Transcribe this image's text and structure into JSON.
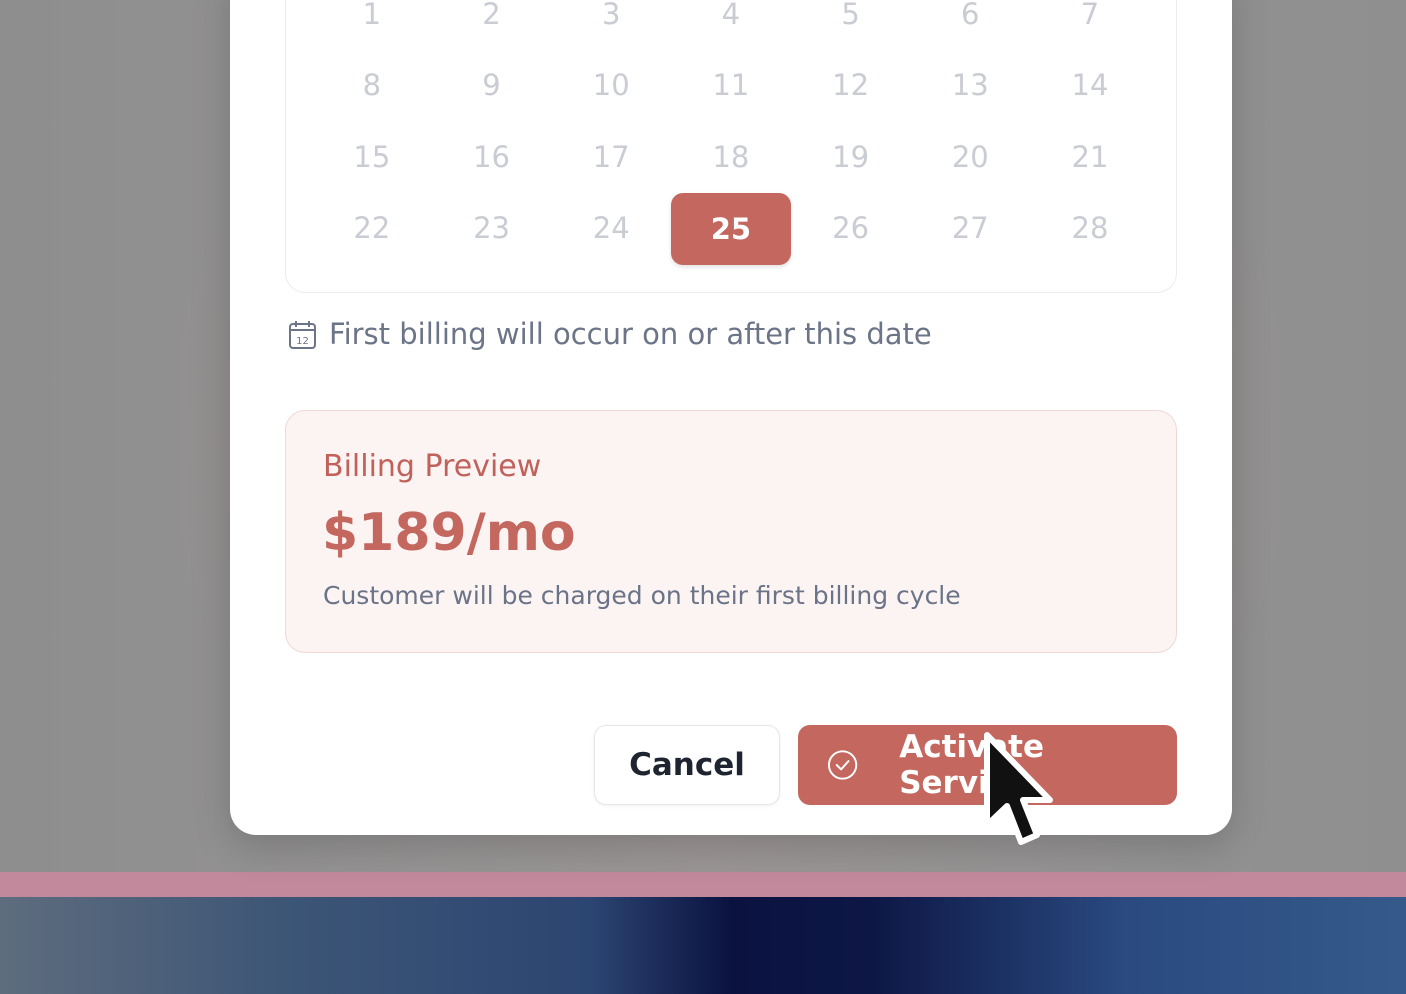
{
  "calendar": {
    "days": [
      "1",
      "2",
      "3",
      "4",
      "5",
      "6",
      "7",
      "8",
      "9",
      "10",
      "11",
      "12",
      "13",
      "14",
      "15",
      "16",
      "17",
      "18",
      "19",
      "20",
      "21",
      "22",
      "23",
      "24",
      "25",
      "26",
      "27",
      "28"
    ],
    "selected_day": "25"
  },
  "hint": {
    "icon": "calendar-icon",
    "text": "First billing will occur on or after this date"
  },
  "billing_preview": {
    "title": "Billing Preview",
    "price": "$189/mo",
    "description": "Customer will be charged on their first billing cycle"
  },
  "actions": {
    "cancel_label": "Cancel",
    "activate_label": "Activate Service",
    "activate_icon": "check-circle-icon"
  },
  "colors": {
    "accent": "#c4675f",
    "muted_text": "#6c7488",
    "disabled_day": "#c9ccd3"
  }
}
